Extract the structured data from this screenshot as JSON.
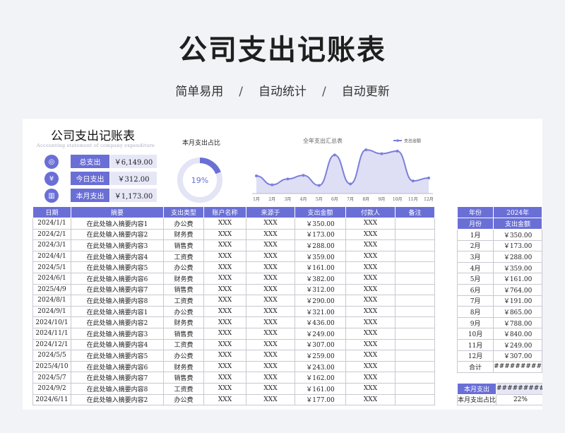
{
  "hero": {
    "title": "公司支出记账表",
    "tags": [
      "简单易用",
      "自动统计",
      "自动更新"
    ],
    "separator": "/"
  },
  "doc": {
    "title": "公司支出记账表",
    "subtitle_en": "Accounting statement of company expenditure"
  },
  "kpis": [
    {
      "label": "总支出",
      "value": "￥6,149.00",
      "icon": "wallet-icon",
      "glyph": "◎"
    },
    {
      "label": "今日支出",
      "value": "￥312.00",
      "icon": "coin-icon",
      "glyph": "¥"
    },
    {
      "label": "本月支出",
      "value": "￥1,173.00",
      "icon": "chart-hand-icon",
      "glyph": "▥"
    }
  ],
  "donut": {
    "title": "本月支出占比",
    "percent_label": "19%",
    "fraction": 0.19
  },
  "chart_data": {
    "type": "area",
    "title": "全年支出汇总表",
    "legend": "支出金额",
    "legend_position": "top-right",
    "categories": [
      "1月",
      "2月",
      "3月",
      "4月",
      "5月",
      "6月",
      "7月",
      "8月",
      "9月",
      "10月",
      "11月",
      "12月"
    ],
    "values": [
      350,
      173,
      288,
      359,
      161,
      764,
      191,
      865,
      788,
      840,
      249,
      307
    ],
    "ylim": [
      0,
      950
    ],
    "colors": {
      "line": "#7b7fdc",
      "fill": "#dedff5"
    }
  },
  "main_table": {
    "headers": [
      "日期",
      "摘要",
      "支出类型",
      "账户名称",
      "来源于",
      "支出金额",
      "付款人",
      "备注"
    ],
    "rows": [
      [
        "2024/1/1",
        "在此处输入摘要内容1",
        "办公费",
        "XXX",
        "XXX",
        "￥350.00",
        "XXX",
        ""
      ],
      [
        "2024/2/1",
        "在此处输入摘要内容2",
        "财务费",
        "XXX",
        "XXX",
        "￥173.00",
        "XXX",
        ""
      ],
      [
        "2024/3/1",
        "在此处输入摘要内容3",
        "销售费",
        "XXX",
        "XXX",
        "￥288.00",
        "XXX",
        ""
      ],
      [
        "2024/4/1",
        "在此处输入摘要内容4",
        "工资费",
        "XXX",
        "XXX",
        "￥359.00",
        "XXX",
        ""
      ],
      [
        "2024/5/1",
        "在此处输入摘要内容5",
        "办公费",
        "XXX",
        "XXX",
        "￥161.00",
        "XXX",
        ""
      ],
      [
        "2024/6/1",
        "在此处输入摘要内容6",
        "财务费",
        "XXX",
        "XXX",
        "￥382.00",
        "XXX",
        ""
      ],
      [
        "2025/4/9",
        "在此处输入摘要内容7",
        "销售费",
        "XXX",
        "XXX",
        "￥312.00",
        "XXX",
        ""
      ],
      [
        "2024/8/1",
        "在此处输入摘要内容8",
        "工资费",
        "XXX",
        "XXX",
        "￥290.00",
        "XXX",
        ""
      ],
      [
        "2024/9/1",
        "在此处输入摘要内容1",
        "办公费",
        "XXX",
        "XXX",
        "￥321.00",
        "XXX",
        ""
      ],
      [
        "2024/10/1",
        "在此处输入摘要内容2",
        "财务费",
        "XXX",
        "XXX",
        "￥436.00",
        "XXX",
        ""
      ],
      [
        "2024/11/1",
        "在此处输入摘要内容3",
        "销售费",
        "XXX",
        "XXX",
        "￥249.00",
        "XXX",
        ""
      ],
      [
        "2024/12/1",
        "在此处输入摘要内容4",
        "工资费",
        "XXX",
        "XXX",
        "￥307.00",
        "XXX",
        ""
      ],
      [
        "2024/5/5",
        "在此处输入摘要内容5",
        "办公费",
        "XXX",
        "XXX",
        "￥259.00",
        "XXX",
        ""
      ],
      [
        "2025/4/10",
        "在此处输入摘要内容6",
        "财务费",
        "XXX",
        "XXX",
        "￥243.00",
        "XXX",
        ""
      ],
      [
        "2024/5/7",
        "在此处输入摘要内容7",
        "销售费",
        "XXX",
        "XXX",
        "￥162.00",
        "XXX",
        ""
      ],
      [
        "2024/9/2",
        "在此处输入摘要内容8",
        "工资费",
        "XXX",
        "XXX",
        "￥161.00",
        "XXX",
        ""
      ],
      [
        "2024/6/11",
        "在此处输入摘要内容2",
        "办公费",
        "XXX",
        "XXX",
        "￥177.00",
        "XXX",
        ""
      ]
    ]
  },
  "side_table": {
    "year_label": "年份",
    "year_value": "2024年",
    "month_header": "月份",
    "amount_header": "支出金额",
    "rows": [
      [
        "1月",
        "￥350.00"
      ],
      [
        "2月",
        "￥173.00"
      ],
      [
        "3月",
        "￥288.00"
      ],
      [
        "4月",
        "￥359.00"
      ],
      [
        "5月",
        "￥161.00"
      ],
      [
        "6月",
        "￥764.00"
      ],
      [
        "7月",
        "￥191.00"
      ],
      [
        "8月",
        "￥865.00"
      ],
      [
        "9月",
        "￥788.00"
      ],
      [
        "10月",
        "￥840.00"
      ],
      [
        "11月",
        "￥249.00"
      ],
      [
        "12月",
        "￥307.00"
      ]
    ],
    "total_label": "合计",
    "total_value": "#########"
  },
  "month_summary": {
    "label": "本月支出",
    "value": "#########",
    "ratio_label": "本月支出占比",
    "ratio_value": "22%"
  }
}
